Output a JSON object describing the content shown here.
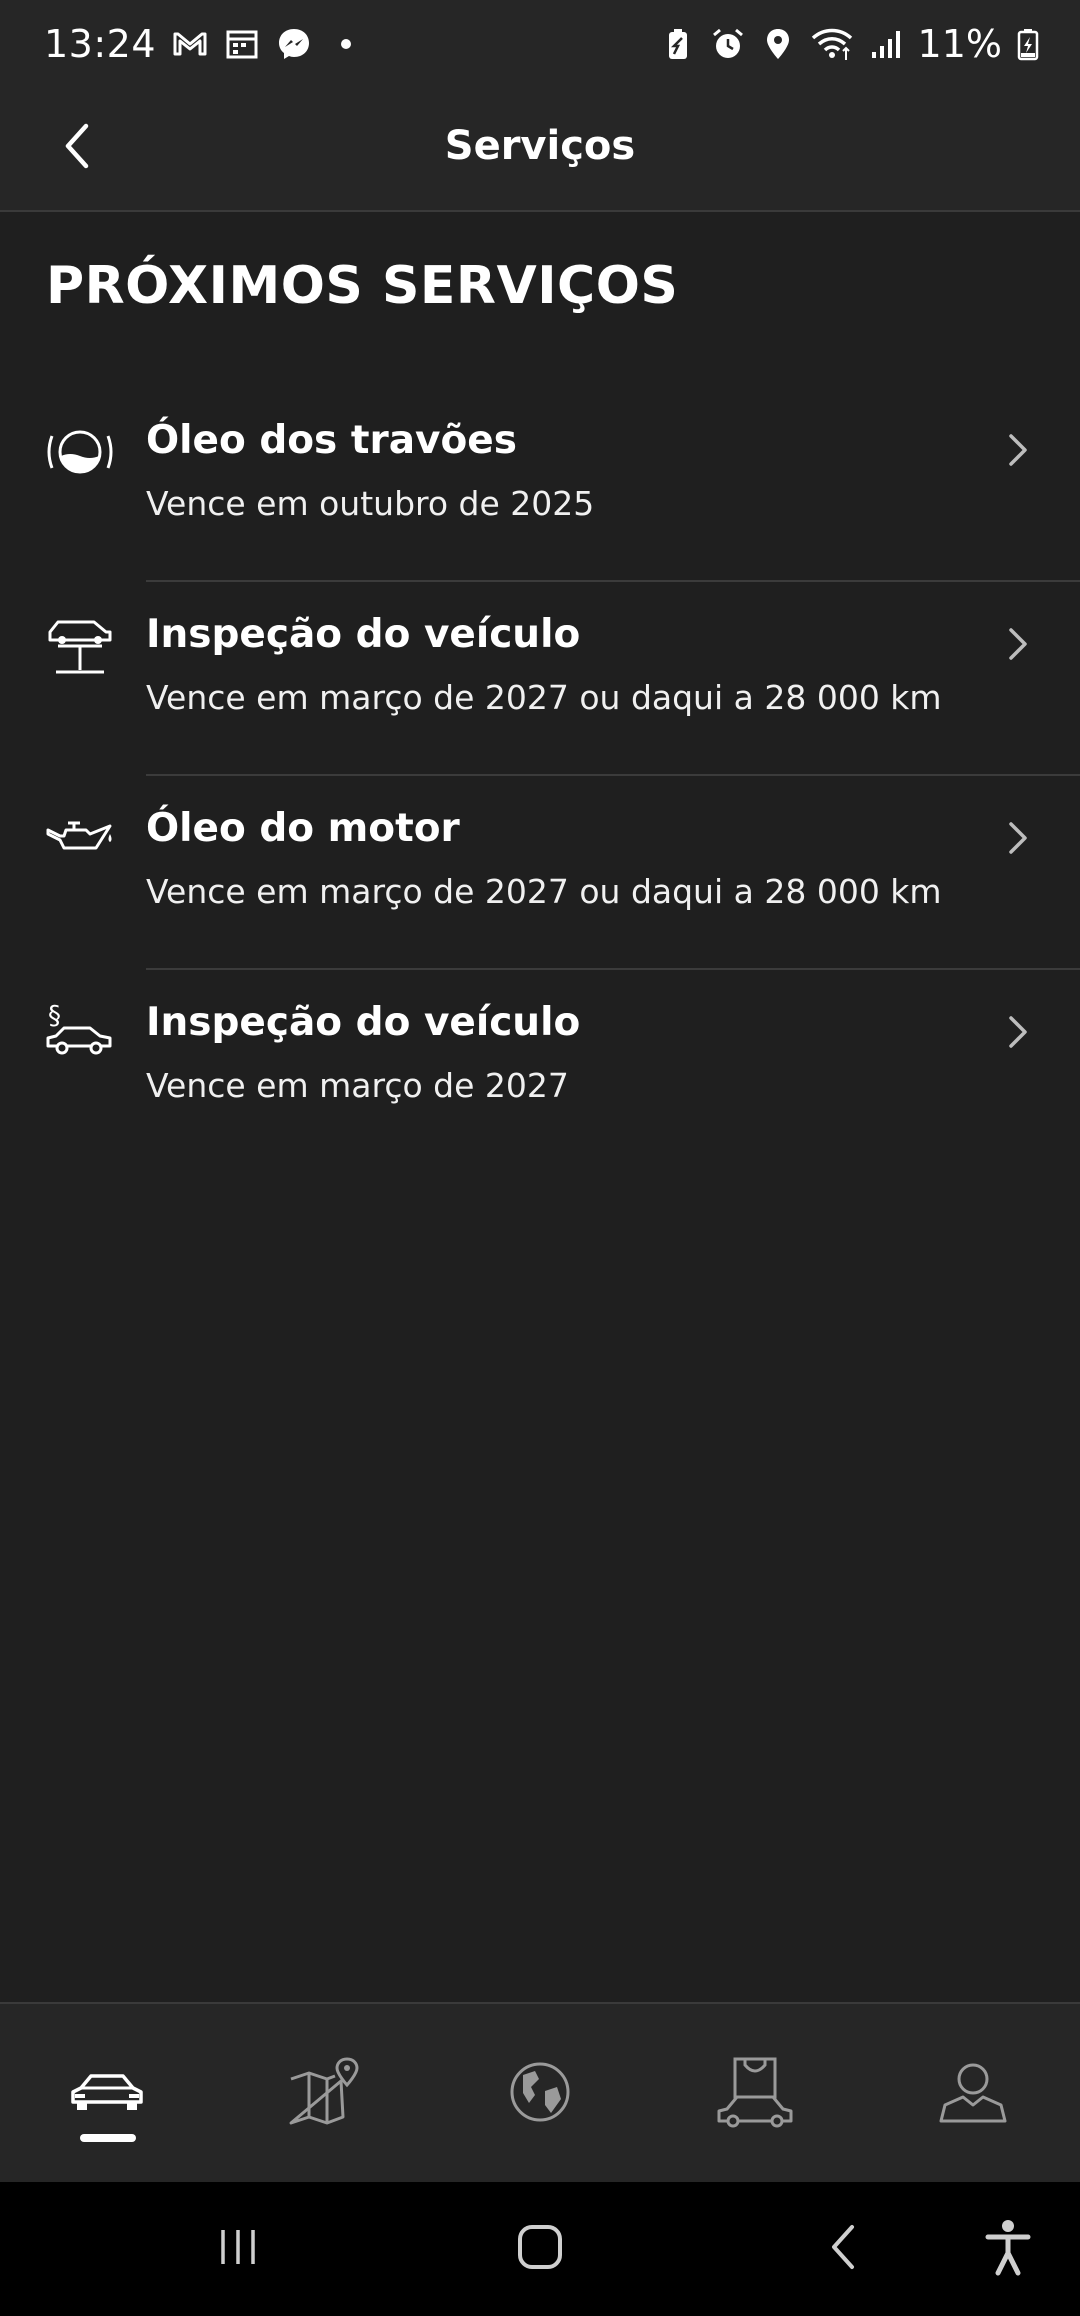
{
  "status_bar": {
    "time": "13:24",
    "battery": "11%",
    "left_icons": [
      "gmail-icon",
      "calendar-icon",
      "messenger-icon",
      "dot-icon"
    ],
    "right_icons": [
      "battery-saver-icon",
      "alarm-icon",
      "location-icon",
      "wifi-icon",
      "signal-icon",
      "battery-charging-icon"
    ]
  },
  "header": {
    "title": "Serviços",
    "back_icon": "chevron-left-icon"
  },
  "section": {
    "title": "PRÓXIMOS SERVIÇOS"
  },
  "services": [
    {
      "icon": "brake-fluid-icon",
      "title": "Óleo dos travões",
      "subtitle": "Vence em outubro de 2025"
    },
    {
      "icon": "vehicle-lift-icon",
      "title": "Inspeção do veículo",
      "subtitle": "Vence em março de 2027 ou daqui a 28 000 km"
    },
    {
      "icon": "oil-can-icon",
      "title": "Óleo do motor",
      "subtitle": "Vence em março de 2027 ou daqui a 28 000 km"
    },
    {
      "icon": "legal-inspection-car-icon",
      "title": "Inspeção do veículo",
      "subtitle": "Vence em março de 2027"
    }
  ],
  "bottom_nav": {
    "items": [
      "car-icon",
      "map-pin-icon",
      "globe-icon",
      "shop-car-icon",
      "profile-icon"
    ],
    "active_index": 0
  },
  "system_nav": [
    "recents-icon",
    "home-icon",
    "back-icon",
    "accessibility-icon"
  ]
}
